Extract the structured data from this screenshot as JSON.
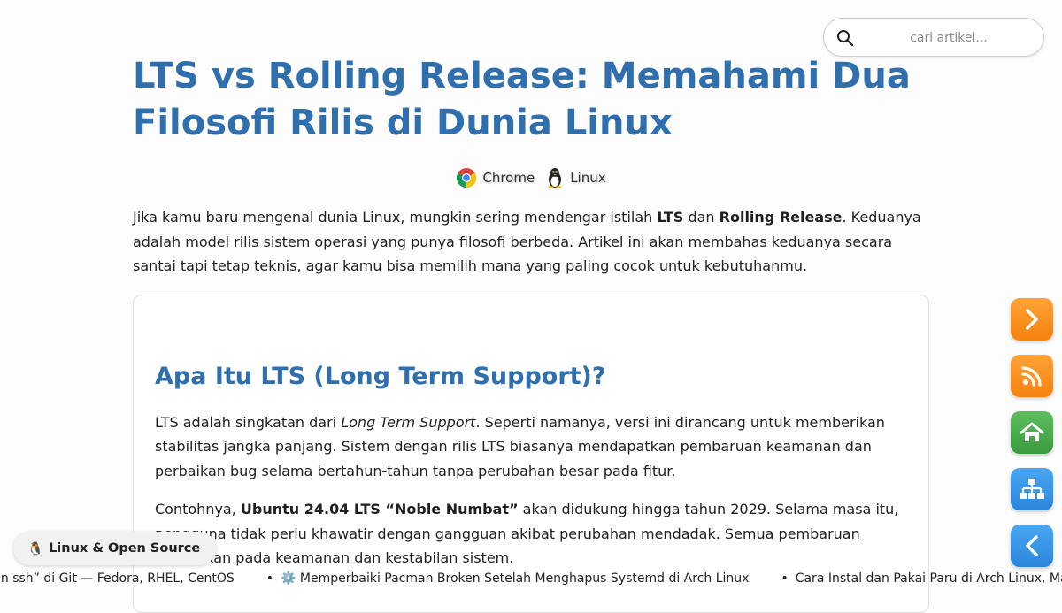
{
  "search": {
    "placeholder": "cari artikel..."
  },
  "article": {
    "title": "LTS vs Rolling Release: Memahami Dua Filosofi Rilis di Dunia Linux",
    "platforms": [
      {
        "icon": "chrome-icon",
        "label": "Chrome"
      },
      {
        "icon": "linux-penguin-icon",
        "label": "Linux"
      }
    ],
    "intro": {
      "t1": "Jika kamu baru mengenal dunia Linux, mungkin sering mendengar istilah ",
      "b1": "LTS",
      "t2": " dan ",
      "b2": "Rolling Release",
      "t3": ". Keduanya adalah model rilis sistem operasi yang punya filosofi berbeda. Artikel ini akan membahas keduanya secara santai tapi tetap teknis, agar kamu bisa memilih mana yang paling cocok untuk kebutuhanmu."
    },
    "section": {
      "heading": "Apa Itu LTS (Long Term Support)?",
      "p1": {
        "t1": "LTS adalah singkatan dari ",
        "i1": "Long Term Support",
        "t2": ". Seperti namanya, versi ini dirancang untuk memberikan stabilitas jangka panjang. Sistem dengan rilis LTS biasanya mendapatkan pembaruan keamanan dan perbaikan bug selama bertahun-tahun tanpa perubahan besar pada fitur."
      },
      "p2": {
        "t1": "Contohnya, ",
        "b1": "Ubuntu 24.04 LTS “Noble Numbat”",
        "t2": " akan didukung hingga tahun 2029. Selama masa itu, pengguna tidak perlu khawatir dengan gangguan akibat perubahan mendadak. Semua pembaruan difokuskan pada keamanan dan kestabilan sistem."
      }
    }
  },
  "side_buttons": [
    {
      "icon": "chevron-right-icon",
      "color": "#f5820f"
    },
    {
      "icon": "rss-icon",
      "color": "#f5820f"
    },
    {
      "icon": "home-icon",
      "color": "#3c9b40"
    },
    {
      "icon": "sitemap-icon",
      "color": "#2b86db"
    },
    {
      "icon": "chevron-left-icon",
      "color": "#2b86db"
    }
  ],
  "category_badge": {
    "icon": "penguin-emoji",
    "label": "Linux & Open Source"
  },
  "ticker": [
    "un ssh” di Git — Fedora, RHEL, CentOS",
    "⚙️ Memperbaiki Pacman Broken Setelah Menghapus Systemd di Arch Linux",
    "Cara Instal dan Pakai Paru di Arch Linux, Manjaro"
  ],
  "colors": {
    "heading": "#2f6fad",
    "accent_orange": "#f5820f",
    "accent_green": "#3c9b40",
    "accent_blue": "#2b86db"
  }
}
